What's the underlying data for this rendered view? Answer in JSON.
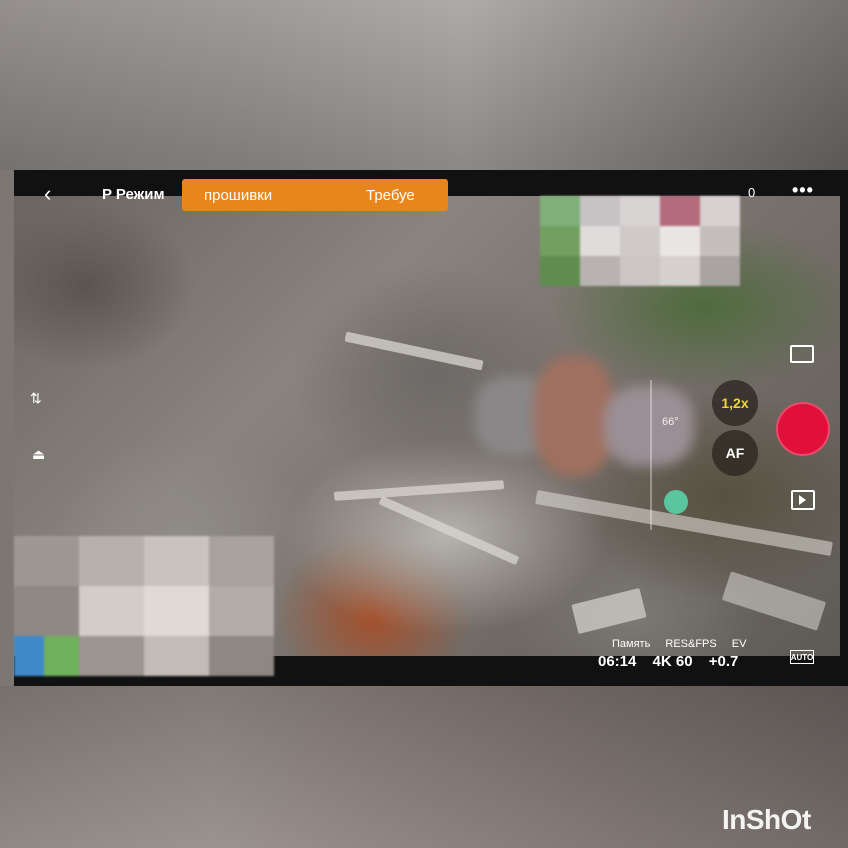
{
  "camera_ui": {
    "mode_label": "P Режим",
    "banner": {
      "left_text": "прошивки",
      "right_text": "Требуе"
    },
    "signal_text": "0",
    "zoom_label": "1,2x",
    "af_label": "AF",
    "ev_readout": "66°",
    "status": {
      "labels": [
        "Память",
        "RES&FPS",
        "EV"
      ],
      "values": [
        "06:14",
        "4K 60",
        "+0.7"
      ],
      "auto_badge": "AUTO"
    }
  },
  "icons": {
    "back": "chevron-left-icon",
    "menu": "more-dots-icon",
    "record": "record-icon",
    "album": "playback-icon",
    "photo": "photo-mode-icon",
    "gimbal": "gimbal-icon",
    "landing": "landing-icon"
  },
  "colors": {
    "banner": "#e8861c",
    "record": "#e0103a",
    "zoom_text": "#f3d23a",
    "ev_dot": "#59c6a0"
  },
  "watermark": "InShOt"
}
